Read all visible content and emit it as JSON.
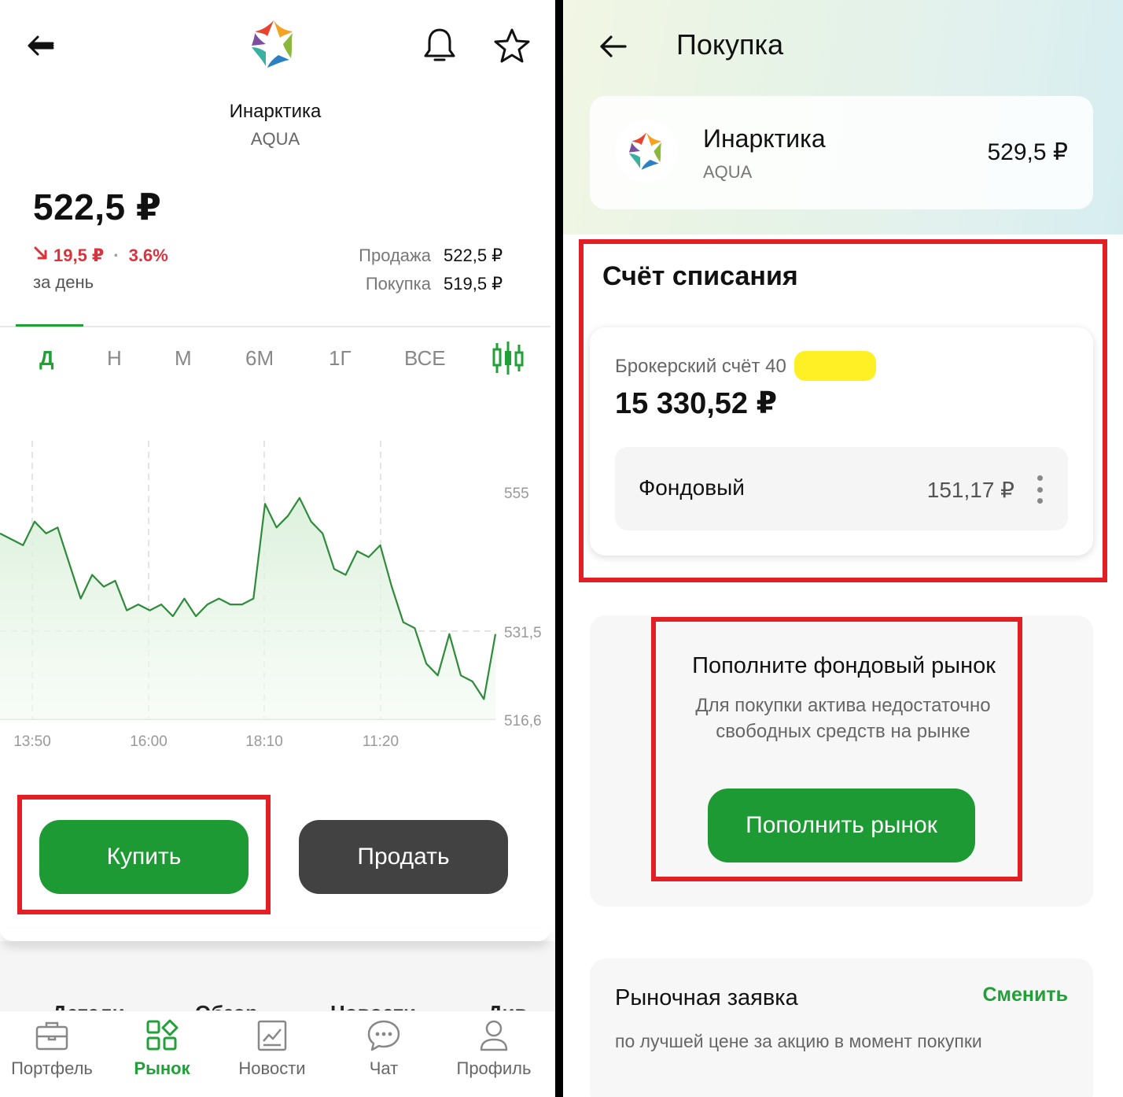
{
  "left": {
    "stock_name": "Инарктика",
    "ticker": "AQUA",
    "price": "522,5 ₽",
    "change_amount": "19,5 ₽",
    "change_percent": "3.6%",
    "change_direction": "down",
    "period_caption": "за день",
    "sell_label": "Продажа",
    "sell_price": "522,5 ₽",
    "buy_label": "Покупка",
    "buy_price": "519,5 ₽",
    "periods": [
      {
        "label": "Д",
        "active": true
      },
      {
        "label": "Н",
        "active": false
      },
      {
        "label": "М",
        "active": false
      },
      {
        "label": "6М",
        "active": false
      },
      {
        "label": "1Г",
        "active": false
      },
      {
        "label": "ВСЕ",
        "active": false
      }
    ],
    "buy_button": "Купить",
    "sell_button": "Продать",
    "subtabs": [
      "Детали",
      "Обзор",
      "Новости",
      "Див"
    ],
    "nav": [
      {
        "label": "Портфель",
        "icon": "briefcase-icon",
        "active": false
      },
      {
        "label": "Рынок",
        "icon": "market-grid-icon",
        "active": true
      },
      {
        "label": "Новости",
        "icon": "news-chart-icon",
        "active": false
      },
      {
        "label": "Чат",
        "icon": "chat-icon",
        "active": false
      },
      {
        "label": "Профиль",
        "icon": "profile-icon",
        "active": false
      }
    ],
    "colors": {
      "accent": "#21a038",
      "negative": "#d9343d",
      "buy_button": "#1e9a35",
      "sell_button": "#424242"
    }
  },
  "chart_data": {
    "type": "area",
    "x_tick_labels": [
      "13:50",
      "16:00",
      "18:10",
      "11:20"
    ],
    "y_tick_labels": [
      "555",
      "531,5",
      "516,6"
    ],
    "ylim": [
      516.6,
      565
    ],
    "grid": true,
    "series": [
      {
        "values": [
          548,
          547,
          546,
          550,
          548,
          549,
          543,
          537,
          541,
          539,
          540,
          535,
          536,
          535,
          536,
          534,
          537,
          534,
          536,
          537,
          536,
          536,
          537,
          553,
          549,
          551,
          554,
          550,
          548,
          542,
          541,
          545,
          544,
          546,
          539,
          533,
          532,
          526,
          524,
          531,
          524,
          523,
          520,
          531
        ],
        "color": "#2e8b3a"
      }
    ]
  },
  "right": {
    "title": "Покупка",
    "stock_name": "Инарктика",
    "ticker": "AQUA",
    "price": "529,5 ₽",
    "section_title": "Счёт списания",
    "account_label": "Брокерский счёт 40",
    "account_balance": "15 330,52 ₽",
    "subaccount_name": "Фондовый",
    "subaccount_amount": "151,17 ₽",
    "topup_title": "Пополните фондовый рынок",
    "topup_desc_line1": "Для покупки актива недостаточно",
    "topup_desc_line2": "свободных средств на рынке",
    "topup_button": "Пополнить рынок",
    "order_title": "Рыночная заявка",
    "order_change": "Сменить",
    "order_desc": "по лучшей цене за акцию в момент покупки"
  }
}
